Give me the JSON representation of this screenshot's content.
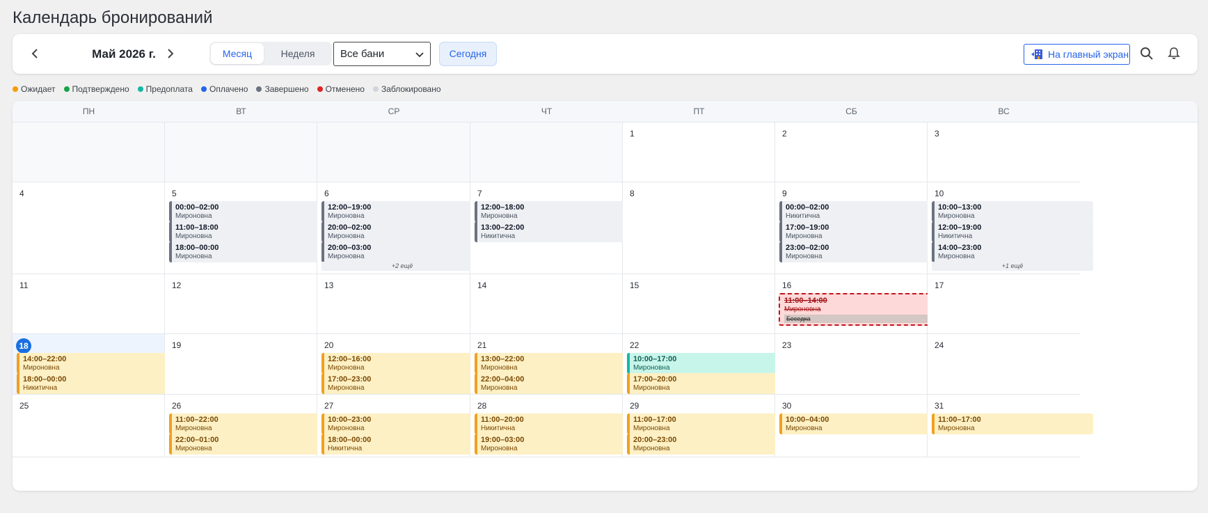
{
  "page": {
    "title": "Календарь бронирований"
  },
  "toolbar": {
    "month_label": "Май 2026 г.",
    "view_month": "Месяц",
    "view_week": "Неделя",
    "bath_select": "Все бани",
    "today": "Сегодня",
    "home": "На главный экран"
  },
  "legend": [
    {
      "label": "Ожидает",
      "color": "#f59e0b"
    },
    {
      "label": "Подтверждено",
      "color": "#16a34a"
    },
    {
      "label": "Предоплата",
      "color": "#14b8a6"
    },
    {
      "label": "Оплачено",
      "color": "#2563eb"
    },
    {
      "label": "Завершено",
      "color": "#6b7280"
    },
    {
      "label": "Отменено",
      "color": "#dc2626"
    },
    {
      "label": "Заблокировано",
      "color": "#d1d5db"
    }
  ],
  "weekdays": [
    "ПН",
    "ВТ",
    "СР",
    "ЧТ",
    "ПТ",
    "СБ",
    "ВС"
  ],
  "weeks": [
    [
      {
        "day": "",
        "outside": true
      },
      {
        "day": "",
        "outside": true
      },
      {
        "day": "",
        "outside": true
      },
      {
        "day": "",
        "outside": true
      },
      {
        "day": "1"
      },
      {
        "day": "2"
      },
      {
        "day": "3"
      }
    ],
    [
      {
        "day": "4"
      },
      {
        "day": "5",
        "events": [
          {
            "time": "00:00–02:00",
            "name": "Мироновна",
            "status": "grey"
          },
          {
            "time": "11:00–18:00",
            "name": "Мироновна",
            "status": "grey"
          },
          {
            "time": "18:00–00:00",
            "name": "Мироновна",
            "status": "grey"
          }
        ]
      },
      {
        "day": "6",
        "events": [
          {
            "time": "12:00–19:00",
            "name": "Мироновна",
            "status": "grey"
          },
          {
            "time": "20:00–02:00",
            "name": "Мироновна",
            "status": "grey"
          },
          {
            "time": "20:00–03:00",
            "name": "Мироновна",
            "status": "grey"
          }
        ],
        "more": "+2 ещё"
      },
      {
        "day": "7",
        "events": [
          {
            "time": "12:00–18:00",
            "name": "Мироновна",
            "status": "grey"
          },
          {
            "time": "13:00–22:00",
            "name": "Никитична",
            "status": "grey"
          }
        ]
      },
      {
        "day": "8"
      },
      {
        "day": "9",
        "events": [
          {
            "time": "00:00–02:00",
            "name": "Никитична",
            "status": "grey"
          },
          {
            "time": "17:00–19:00",
            "name": "Мироновна",
            "status": "grey"
          },
          {
            "time": "23:00–02:00",
            "name": "Мироновна",
            "status": "grey"
          }
        ]
      },
      {
        "day": "10",
        "events": [
          {
            "time": "10:00–13:00",
            "name": "Мироновна",
            "status": "grey"
          },
          {
            "time": "12:00–19:00",
            "name": "Никитична",
            "status": "grey"
          },
          {
            "time": "14:00–23:00",
            "name": "Мироновна",
            "status": "grey"
          }
        ],
        "more": "+1 ещё"
      }
    ],
    [
      {
        "day": "11"
      },
      {
        "day": "12"
      },
      {
        "day": "13"
      },
      {
        "day": "14"
      },
      {
        "day": "15"
      },
      {
        "day": "16",
        "cancelled": {
          "time": "11:00–14:00",
          "name": "Мироновна",
          "tag": "Беседка"
        }
      },
      {
        "day": "17"
      }
    ],
    [
      {
        "day": "18",
        "today": true,
        "events": [
          {
            "time": "14:00–22:00",
            "name": "Мироновна",
            "status": "yellow"
          },
          {
            "time": "18:00–00:00",
            "name": "Никитична",
            "status": "yellow"
          }
        ]
      },
      {
        "day": "19"
      },
      {
        "day": "20",
        "events": [
          {
            "time": "12:00–16:00",
            "name": "Мироновна",
            "status": "yellow"
          },
          {
            "time": "17:00–23:00",
            "name": "Мироновна",
            "status": "yellow"
          }
        ]
      },
      {
        "day": "21",
        "events": [
          {
            "time": "13:00–22:00",
            "name": "Мироновна",
            "status": "yellow"
          },
          {
            "time": "22:00–04:00",
            "name": "Мироновна",
            "status": "yellow"
          }
        ]
      },
      {
        "day": "22",
        "events": [
          {
            "time": "10:00–17:00",
            "name": "Мироновна",
            "status": "teal"
          },
          {
            "time": "17:00–20:00",
            "name": "Мироновна",
            "status": "yellow"
          }
        ]
      },
      {
        "day": "23"
      },
      {
        "day": "24"
      }
    ],
    [
      {
        "day": "25"
      },
      {
        "day": "26",
        "events": [
          {
            "time": "11:00–22:00",
            "name": "Мироновна",
            "status": "yellow"
          },
          {
            "time": "22:00–01:00",
            "name": "Мироновна",
            "status": "yellow"
          }
        ]
      },
      {
        "day": "27",
        "events": [
          {
            "time": "10:00–23:00",
            "name": "Мироновна",
            "status": "yellow"
          },
          {
            "time": "18:00–00:00",
            "name": "Никитична",
            "status": "yellow"
          }
        ]
      },
      {
        "day": "28",
        "events": [
          {
            "time": "11:00–20:00",
            "name": "Никитична",
            "status": "yellow"
          },
          {
            "time": "19:00–03:00",
            "name": "Мироновна",
            "status": "yellow"
          }
        ]
      },
      {
        "day": "29",
        "events": [
          {
            "time": "11:00–17:00",
            "name": "Мироновна",
            "status": "yellow"
          },
          {
            "time": "20:00–23:00",
            "name": "Мироновна",
            "status": "yellow"
          }
        ]
      },
      {
        "day": "30",
        "events": [
          {
            "time": "10:00–04:00",
            "name": "Мироновна",
            "status": "yellow"
          }
        ]
      },
      {
        "day": "31",
        "events": [
          {
            "time": "11:00–17:00",
            "name": "Мироновна",
            "status": "yellow"
          }
        ]
      }
    ]
  ]
}
